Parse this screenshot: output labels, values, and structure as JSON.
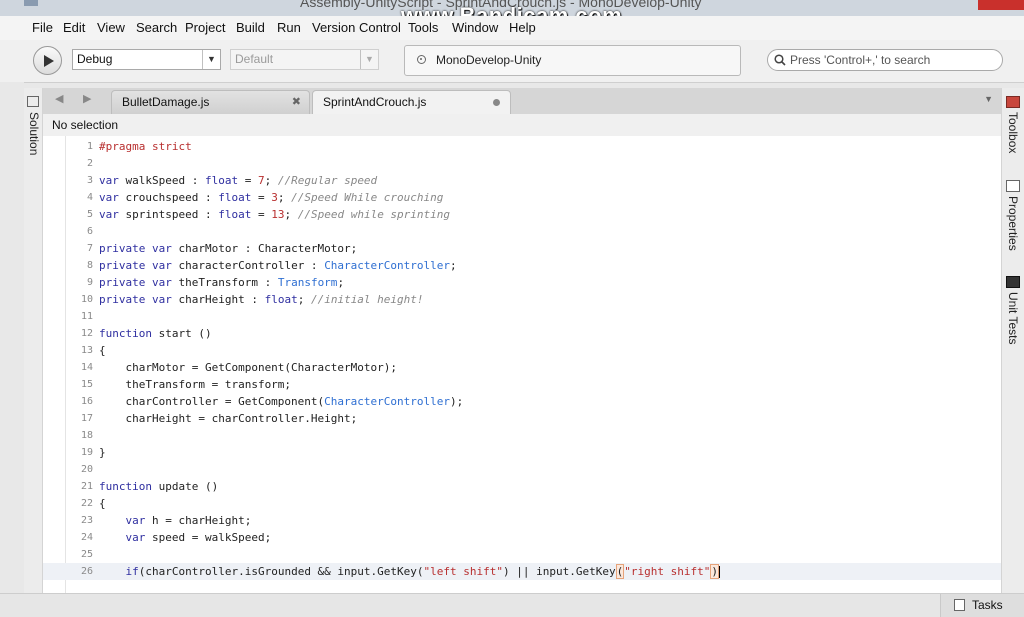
{
  "window": {
    "title": "Assembly-UnityScript - SprintAndCrouch.js - MonoDevelop-Unity",
    "watermark": "www.Bandicam.com"
  },
  "menu": [
    "File",
    "Edit",
    "View",
    "Search",
    "Project",
    "Build",
    "Run",
    "Version Control",
    "Tools",
    "Window",
    "Help"
  ],
  "toolbar": {
    "config": "Debug",
    "platform": "Default",
    "status": "MonoDevelop-Unity",
    "search_placeholder": "Press 'Control+,' to search"
  },
  "left_pad": {
    "label": "Solution"
  },
  "right_pads": [
    "Toolbox",
    "Properties",
    "Unit Tests"
  ],
  "tabs": [
    {
      "label": "BulletDamage.js",
      "active": false
    },
    {
      "label": "SprintAndCrouch.js",
      "active": true
    }
  ],
  "breadcrumb": "No selection",
  "code_lines": [
    {
      "n": "1",
      "html": "<span class=\"pp\">#pragma strict</span>"
    },
    {
      "n": "2",
      "html": ""
    },
    {
      "n": "3",
      "html": "<span class=\"kw\">var</span> walkSpeed : <span class=\"kw\">float</span> = <span class=\"num\">7</span>; <span class=\"cm\">//Regular speed</span>"
    },
    {
      "n": "4",
      "html": "<span class=\"kw\">var</span> crouchspeed : <span class=\"kw\">float</span> = <span class=\"num\">3</span>; <span class=\"cm\">//Speed While crouching</span>"
    },
    {
      "n": "5",
      "html": "<span class=\"kw\">var</span> sprintspeed : <span class=\"kw\">float</span> = <span class=\"num\">13</span>; <span class=\"cm\">//Speed while sprinting</span>"
    },
    {
      "n": "6",
      "html": ""
    },
    {
      "n": "7",
      "html": "<span class=\"kw\">private</span> <span class=\"kw\">var</span> charMotor : CharacterMotor;"
    },
    {
      "n": "8",
      "html": "<span class=\"kw\">private</span> <span class=\"kw\">var</span> characterController : <span class=\"ty\">CharacterController</span>;"
    },
    {
      "n": "9",
      "html": "<span class=\"kw\">private</span> <span class=\"kw\">var</span> theTransform : <span class=\"ty\">Transform</span>;"
    },
    {
      "n": "10",
      "html": "<span class=\"kw\">private</span> <span class=\"kw\">var</span> charHeight : <span class=\"kw\">float</span>; <span class=\"cm\">//initial height!</span>"
    },
    {
      "n": "11",
      "html": ""
    },
    {
      "n": "12",
      "html": "<span class=\"kw\">function</span> start ()"
    },
    {
      "n": "13",
      "html": "{"
    },
    {
      "n": "14",
      "html": "    charMotor = GetComponent(CharacterMotor);"
    },
    {
      "n": "15",
      "html": "    theTransform = transform;"
    },
    {
      "n": "16",
      "html": "    charController = GetComponent(<span class=\"ty\">CharacterController</span>);"
    },
    {
      "n": "17",
      "html": "    charHeight = charController.Height;"
    },
    {
      "n": "18",
      "html": ""
    },
    {
      "n": "19",
      "html": "}"
    },
    {
      "n": "20",
      "html": ""
    },
    {
      "n": "21",
      "html": "<span class=\"kw\">function</span> update ()"
    },
    {
      "n": "22",
      "html": "{"
    },
    {
      "n": "23",
      "html": "    <span class=\"kw\">var</span> h = charHeight;"
    },
    {
      "n": "24",
      "html": "    <span class=\"kw\">var</span> speed = walkSpeed;"
    },
    {
      "n": "25",
      "html": ""
    },
    {
      "n": "26",
      "html": "    <span class=\"kw\">if</span>(charController.isGrounded &amp;&amp; input.GetKey(<span class=\"str\">\"left shift\"</span>) || input.GetKey<span class=\"brk\">(</span><span class=\"str\">\"right shift\"</span><span class=\"brk\">)</span><span class=\"caret\"></span>",
      "current": true
    }
  ],
  "status": {
    "tasks": "Tasks"
  }
}
